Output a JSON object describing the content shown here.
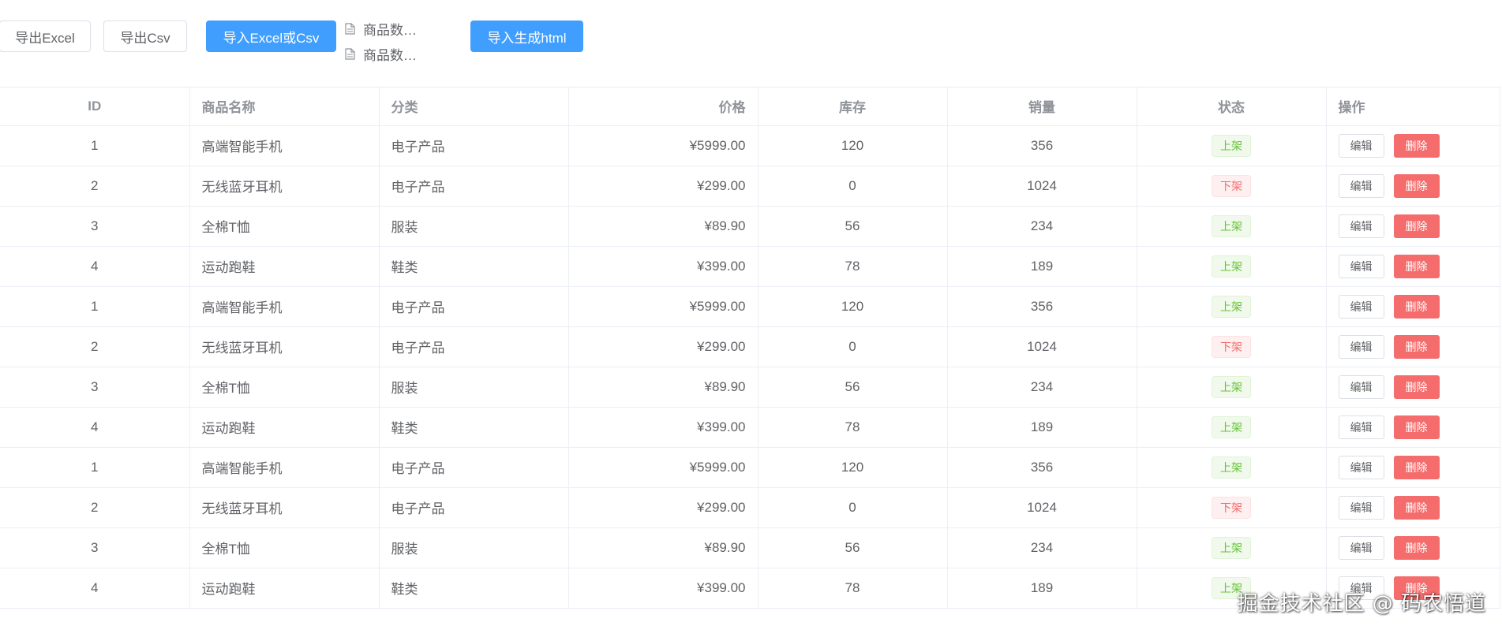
{
  "toolbar": {
    "export_excel_label": "导出Excel",
    "export_csv_label": "导出Csv",
    "import_label": "导入Excel或Csv",
    "import_html_label": "导入生成html",
    "files": [
      "商品数…",
      "商品数…"
    ]
  },
  "table": {
    "headers": {
      "id": "ID",
      "name": "商品名称",
      "category": "分类",
      "price": "价格",
      "stock": "库存",
      "sales": "销量",
      "status": "状态",
      "actions": "操作"
    },
    "edit_label": "编辑",
    "delete_label": "删除",
    "rows": [
      {
        "id": "1",
        "name": "高端智能手机",
        "category": "电子产品",
        "price": "¥5999.00",
        "stock": "120",
        "sales": "356",
        "status": "上架",
        "status_on": true
      },
      {
        "id": "2",
        "name": "无线蓝牙耳机",
        "category": "电子产品",
        "price": "¥299.00",
        "stock": "0",
        "sales": "1024",
        "status": "下架",
        "status_on": false
      },
      {
        "id": "3",
        "name": "全棉T恤",
        "category": "服装",
        "price": "¥89.90",
        "stock": "56",
        "sales": "234",
        "status": "上架",
        "status_on": true
      },
      {
        "id": "4",
        "name": "运动跑鞋",
        "category": "鞋类",
        "price": "¥399.00",
        "stock": "78",
        "sales": "189",
        "status": "上架",
        "status_on": true
      },
      {
        "id": "1",
        "name": "高端智能手机",
        "category": "电子产品",
        "price": "¥5999.00",
        "stock": "120",
        "sales": "356",
        "status": "上架",
        "status_on": true
      },
      {
        "id": "2",
        "name": "无线蓝牙耳机",
        "category": "电子产品",
        "price": "¥299.00",
        "stock": "0",
        "sales": "1024",
        "status": "下架",
        "status_on": false
      },
      {
        "id": "3",
        "name": "全棉T恤",
        "category": "服装",
        "price": "¥89.90",
        "stock": "56",
        "sales": "234",
        "status": "上架",
        "status_on": true
      },
      {
        "id": "4",
        "name": "运动跑鞋",
        "category": "鞋类",
        "price": "¥399.00",
        "stock": "78",
        "sales": "189",
        "status": "上架",
        "status_on": true
      },
      {
        "id": "1",
        "name": "高端智能手机",
        "category": "电子产品",
        "price": "¥5999.00",
        "stock": "120",
        "sales": "356",
        "status": "上架",
        "status_on": true
      },
      {
        "id": "2",
        "name": "无线蓝牙耳机",
        "category": "电子产品",
        "price": "¥299.00",
        "stock": "0",
        "sales": "1024",
        "status": "下架",
        "status_on": false
      },
      {
        "id": "3",
        "name": "全棉T恤",
        "category": "服装",
        "price": "¥89.90",
        "stock": "56",
        "sales": "234",
        "status": "上架",
        "status_on": true
      },
      {
        "id": "4",
        "name": "运动跑鞋",
        "category": "鞋类",
        "price": "¥399.00",
        "stock": "78",
        "sales": "189",
        "status": "上架",
        "status_on": true
      }
    ]
  },
  "watermark": "掘金技术社区 @ 码农悟道",
  "colors": {
    "primary": "#409eff",
    "danger": "#f56c6c",
    "success": "#67c23a"
  }
}
